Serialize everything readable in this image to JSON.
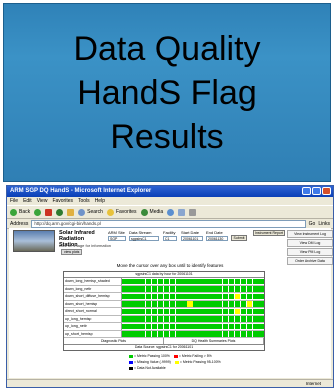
{
  "slide": {
    "title_lines": [
      "Data Quality",
      "HandS Flag",
      "Results"
    ]
  },
  "browser": {
    "window_title": "ARM SGP DQ HandS - Microsoft Internet Explorer",
    "menu": [
      "File",
      "Edit",
      "View",
      "Favorites",
      "Tools",
      "Help"
    ],
    "toolbar": {
      "back": "Back",
      "search": "Search",
      "favorites": "Favorites",
      "media": "Media"
    },
    "address_label": "Address",
    "address_value": "http://dq.arm.gov/cgi-bin/hands.pl",
    "go_label": "Go",
    "links_label": "Links",
    "status_zone": "Internet"
  },
  "page": {
    "station_title": "Solar Infrared Radiation Station",
    "thumb_caption": "click on image for information",
    "view_label": "view plots",
    "controls": [
      {
        "label": "ARM Site",
        "value": "SGP"
      },
      {
        "label": "Data Stream",
        "value": "sgpsirsC1"
      },
      {
        "label": "Facility",
        "value": "C1"
      },
      {
        "label": "Start Date",
        "value": "20061101"
      },
      {
        "label": "End Date",
        "value": "20061130"
      }
    ],
    "submit_label": "Submit",
    "side_links": [
      "View Instrument Log",
      "View DM Log",
      "View PM Log",
      "Order Archive Data"
    ],
    "instrument_report_label": "Instrument Report",
    "instruction": "Move the cursor over any box until to identify features",
    "grid_header": "sgpsirsC1 data by hour for 20061101",
    "rows": [
      {
        "label": "down_long_hemisp_shaded",
        "cells": "gggggggggggggggggggggggg"
      },
      {
        "label": "down_long_netir",
        "cells": "gggggggggggggggggggggggg"
      },
      {
        "label": "down_short_diffuse_hemisp",
        "cells": "gggggggggggggggggggygggg"
      },
      {
        "label": "down_short_hemisp",
        "cells": "gggggggggggygggggggggygg"
      },
      {
        "label": "direct_short_normal",
        "cells": "gggggggggggggggggggygggg"
      },
      {
        "label": "up_long_hemisp",
        "cells": "gggggggggggggggggggggggg"
      },
      {
        "label": "up_long_netir",
        "cells": "gggggggggggggggggggggggg"
      },
      {
        "label": "up_short_hemisp",
        "cells": "gggggggggggggggggggggggg"
      }
    ],
    "foot_cells": [
      "Diagnostic Plots",
      "DQ Health Summaries Plots"
    ],
    "source": "Data Source: sgpsirsC1 for 20061101",
    "legend": [
      {
        "color": "#00cc00",
        "label": "= Metric Passing 100%"
      },
      {
        "color": "#ff0000",
        "label": "= Metric Failing > 5%"
      },
      {
        "color": "#0000ff",
        "label": "= Missing Value (-9999)"
      },
      {
        "color": "#ffff00",
        "label": "= Metric Passing 95-100%"
      },
      {
        "color": "#000000",
        "label": "= Data Not Available"
      }
    ]
  },
  "colors": {
    "green": "#00cc00",
    "yellow": "#ffff00",
    "title_blue": "#3b92c6"
  }
}
